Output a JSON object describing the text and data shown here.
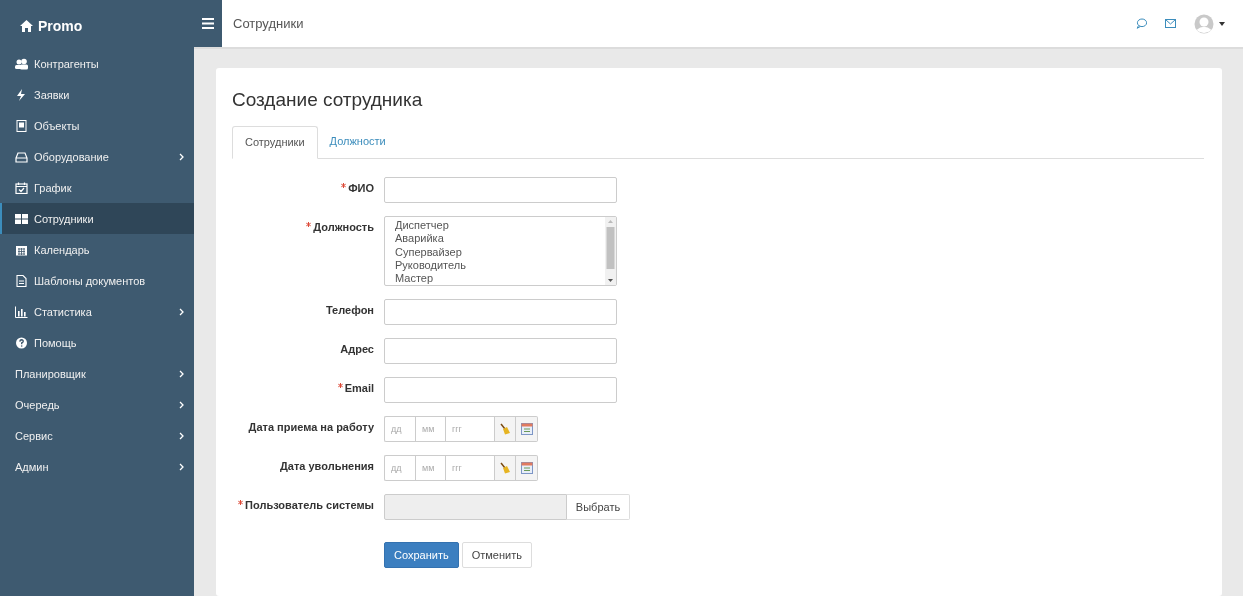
{
  "brand": "Promo",
  "sidebar": {
    "items": [
      {
        "label": "Контрагенты",
        "selected": false,
        "expandable": false
      },
      {
        "label": "Заявки",
        "selected": false,
        "expandable": false
      },
      {
        "label": "Объекты",
        "selected": false,
        "expandable": false
      },
      {
        "label": "Оборудование",
        "selected": false,
        "expandable": true
      },
      {
        "label": "График",
        "selected": false,
        "expandable": false
      },
      {
        "label": "Сотрудники",
        "selected": true,
        "expandable": false
      },
      {
        "label": "Календарь",
        "selected": false,
        "expandable": false
      },
      {
        "label": "Шаблоны документов",
        "selected": false,
        "expandable": false
      },
      {
        "label": "Статистика",
        "selected": false,
        "expandable": true
      },
      {
        "label": "Помощь",
        "selected": false,
        "expandable": false
      },
      {
        "label": "Планировщик",
        "selected": false,
        "expandable": true
      },
      {
        "label": "Очередь",
        "selected": false,
        "expandable": true
      },
      {
        "label": "Сервис",
        "selected": false,
        "expandable": true
      },
      {
        "label": "Админ",
        "selected": false,
        "expandable": true
      }
    ]
  },
  "header": {
    "title": "Сотрудники"
  },
  "card": {
    "title": "Создание сотрудника",
    "tabs": [
      {
        "label": "Сотрудники",
        "selected": true
      },
      {
        "label": "Должности",
        "selected": false
      }
    ],
    "fields": [
      {
        "kind": "text",
        "label": "ФИО",
        "required": true
      },
      {
        "kind": "listbox",
        "label": "Должность",
        "required": true,
        "options": [
          "Диспетчер",
          "Аварийка",
          "Супервайзер",
          "Руководитель",
          "Мастер"
        ]
      },
      {
        "kind": "text",
        "label": "Телефон",
        "required": false
      },
      {
        "kind": "text",
        "label": "Адрес",
        "required": false
      },
      {
        "kind": "text",
        "label": "Email",
        "required": true
      },
      {
        "kind": "date",
        "label": "Дата приема на работу",
        "required": false,
        "placeholders": [
          "дд",
          "мм",
          "ггг"
        ]
      },
      {
        "kind": "date",
        "label": "Дата увольнения",
        "required": false,
        "placeholders": [
          "дд",
          "мм",
          "ггг"
        ]
      },
      {
        "kind": "picker",
        "label": "Пользователь системы",
        "required": true,
        "button": "Выбрать"
      }
    ],
    "buttons": [
      {
        "label": "Сохранить",
        "kind": "primary"
      },
      {
        "label": "Отменить",
        "kind": "default"
      }
    ]
  }
}
